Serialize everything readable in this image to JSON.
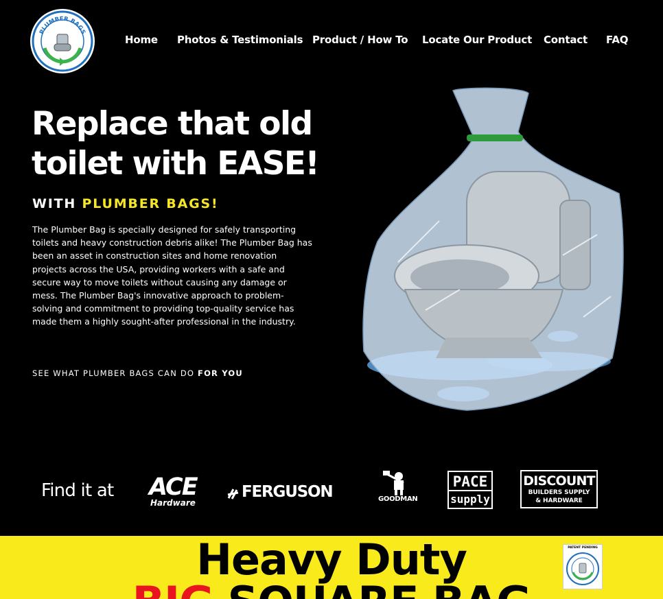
{
  "header": {
    "logo_text": "PLUMBER BAGS",
    "nav": [
      {
        "label": "Home"
      },
      {
        "label": "Photos & Testimonials"
      },
      {
        "label": "Product / How To"
      },
      {
        "label": "Locate Our Product"
      },
      {
        "label": "Contact"
      },
      {
        "label": "FAQ"
      }
    ]
  },
  "hero": {
    "title_line1": "Replace that old",
    "title_line2": "toilet with EASE!",
    "subtitle_white": "WITH ",
    "subtitle_yellow": "PLUMBER BAGS!",
    "body": "The Plumber Bag is specially designed for safely transporting toilets and heavy construction debris alike! The Plumber Bag has been an asset in construction sites and home renovation projects across the USA, providing workers with a safe and secure way to move toilets without causing any damage or mess. The Plumber Bag's innovative approach to problem-solving and commitment to providing top-quality service has made them a highly sought-after professional in the industry.",
    "cta_normal": "SEE WHAT PLUMBER BAGS CAN DO ",
    "cta_bold": "FOR YOU",
    "image_icon": "toilet-in-bag-illustration"
  },
  "retailers": {
    "label": "Find it at",
    "ace": {
      "word": "ACE",
      "sub": "Hardware"
    },
    "ferguson": {
      "word": "FERGUSON"
    },
    "goodman": {
      "word": "GOODMAN"
    },
    "pace": {
      "top": "PACE",
      "bottom": "supply"
    },
    "discount": {
      "line1": "DISCOUNT",
      "line2": "BUILDERS SUPPLY",
      "line3": "& HARDWARE"
    }
  },
  "banner": {
    "line1": "Heavy Duty",
    "line2_red": "BIG",
    "line2_black": " SQUARE BAG",
    "badge_label": "PATENT PENDING"
  },
  "colors": {
    "background": "#000000",
    "accent_yellow": "#f5e626",
    "banner_yellow": "#f9ea1c",
    "banner_red": "#e8141e",
    "logo_blue": "#1f6fbf",
    "logo_green": "#3bb34a"
  }
}
